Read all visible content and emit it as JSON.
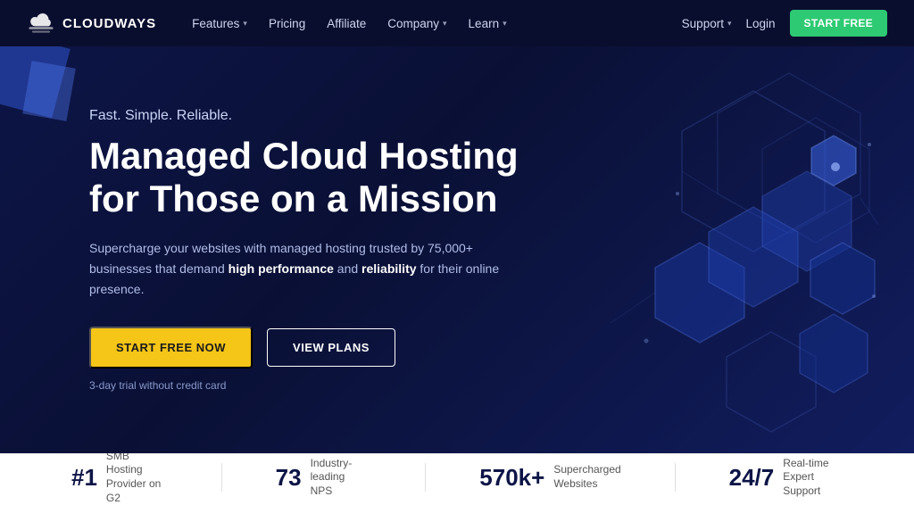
{
  "navbar": {
    "logo_text": "CLOUDWAYS",
    "nav_items": [
      {
        "label": "Features",
        "has_arrow": true
      },
      {
        "label": "Pricing",
        "has_arrow": false
      },
      {
        "label": "Affiliate",
        "has_arrow": false
      },
      {
        "label": "Company",
        "has_arrow": true
      },
      {
        "label": "Learn",
        "has_arrow": true
      }
    ],
    "support_label": "Support",
    "login_label": "Login",
    "start_free_label": "START FREE"
  },
  "hero": {
    "tagline": "Fast. Simple. Reliable.",
    "title_line1": "Managed Cloud Hosting",
    "title_line2": "for Those on a Mission",
    "description_pre": "Supercharge your websites with managed hosting trusted by 75,000+ businesses that demand ",
    "description_bold1": "high performance",
    "description_mid": " and ",
    "description_bold2": "reliability",
    "description_post": " for their online presence.",
    "btn_start": "START FREE NOW",
    "btn_plans": "VIEW PLANS",
    "trial_note": "3-day trial without credit card"
  },
  "stats": [
    {
      "number": "#1",
      "description": "SMB Hosting\nProvider on G2"
    },
    {
      "number": "73",
      "description": "Industry-leading\nNPS"
    },
    {
      "number": "570k+",
      "description": "Supercharged\nWebsites"
    },
    {
      "number": "24/7",
      "description": "Real-time\nExpert Support"
    }
  ],
  "colors": {
    "navbar_bg": "#0a0e2e",
    "hero_bg": "#0d1547",
    "accent_green": "#2dca73",
    "accent_yellow": "#f5c518",
    "stat_bar_bg": "#ffffff"
  }
}
